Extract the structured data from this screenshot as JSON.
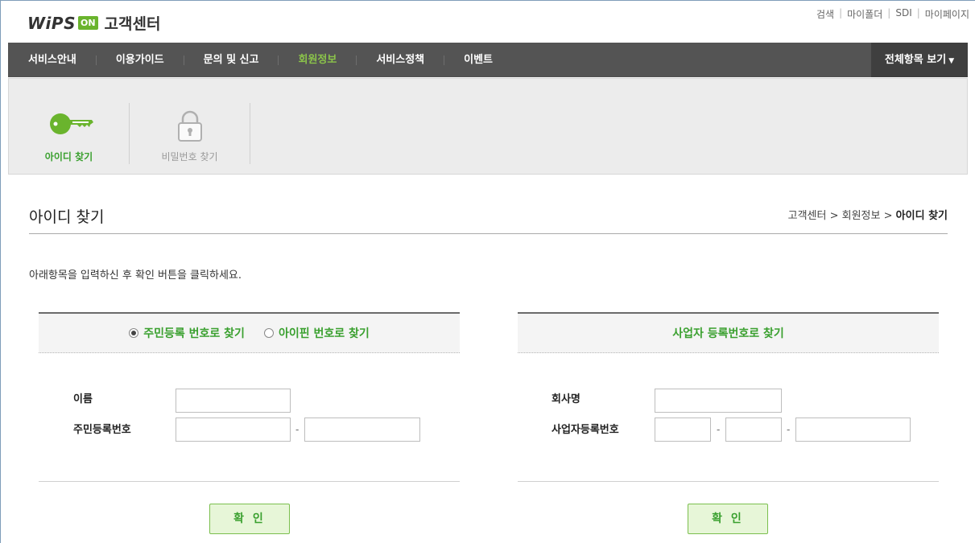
{
  "header": {
    "logo_wips": "WiPS",
    "logo_on": "ON",
    "logo_title": "고객센터",
    "util_links": [
      "검색",
      "마이폴더",
      "SDI",
      "마이페이지"
    ]
  },
  "gnb": {
    "items": [
      "서비스안내",
      "이용가이드",
      "문의 및 신고",
      "회원정보",
      "서비스정책",
      "이벤트"
    ],
    "active_index": 3,
    "all_label": "전체항목 보기"
  },
  "subtabs": {
    "find_id": "아이디 찾기",
    "find_pw": "비밀번호 찾기"
  },
  "page": {
    "title": "아이디 찾기",
    "breadcrumb_1": "고객센터",
    "breadcrumb_2": "회원정보",
    "breadcrumb_current": "아이디 찾기",
    "breadcrumb_sep": ">",
    "instruction": "아래항목을 입력하신 후 확인 버튼을 클릭하세요."
  },
  "personal": {
    "radio_1": "주민등록 번호로 찾기",
    "radio_2": "아이핀 번호로 찾기",
    "radio_selected": 1,
    "name_label": "이름",
    "rrn_label": "주민등록번호",
    "dash": "-",
    "confirm": "확 인"
  },
  "business": {
    "head": "사업자 등록번호로 찾기",
    "company_label": "회사명",
    "bizno_label": "사업자등록번호",
    "dash": "-",
    "confirm": "확 인"
  },
  "colors": {
    "accent_green": "#3aa02f",
    "gnb_bg": "#545454",
    "logo_on_bg": "#6ab42d"
  }
}
